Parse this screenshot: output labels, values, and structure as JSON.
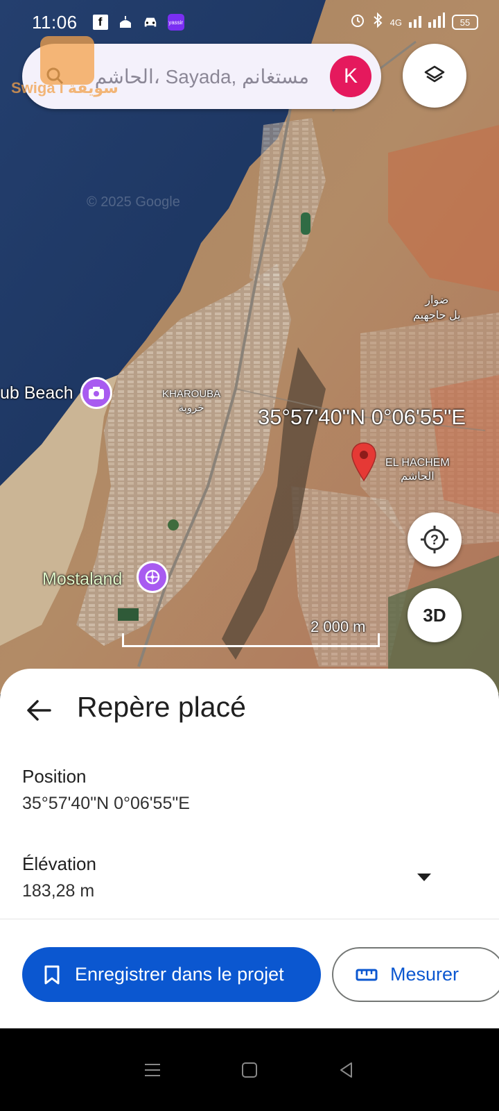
{
  "status_bar": {
    "time": "11:06",
    "network": "4G",
    "battery": "55",
    "app_icons": [
      "facebook-icon",
      "mosque-icon",
      "car-icon",
      "yassir-icon"
    ]
  },
  "search": {
    "text": "الحاشم، Sayada, مستغانم",
    "avatar_letter": "K"
  },
  "watermark": {
    "text": "Swiga l سويقة"
  },
  "map": {
    "labels": {
      "club_beach": "ub Beach",
      "kharouba_latin": "KHAROUBA",
      "kharouba_arabic": "خروبة",
      "el_hachem_latin": "EL HACHEM",
      "el_hachem_arabic": "الحاشم",
      "douar_line1": "ضوار",
      "douar_line2": "يل حاجهيم",
      "mostaland": "Mostaland",
      "coordinates": "35°57'40\"N 0°06'55\"E",
      "copyright": "© 2025 Google"
    },
    "scale_text": "2 000 m",
    "button_3d": "3D",
    "colors": {
      "sea": "#1c3a66",
      "land": "#b48a62",
      "poi": "#a85bf0",
      "pin": "#e53935"
    }
  },
  "sheet": {
    "title": "Repère placé",
    "position_label": "Position",
    "position_value": "35°57'40\"N 0°06'55\"E",
    "elevation_label": "Élévation",
    "elevation_value": "183,28 m",
    "save_button": "Enregistrer dans le projet",
    "measure_button": "Mesurer",
    "accent_color": "#0b57d0"
  }
}
